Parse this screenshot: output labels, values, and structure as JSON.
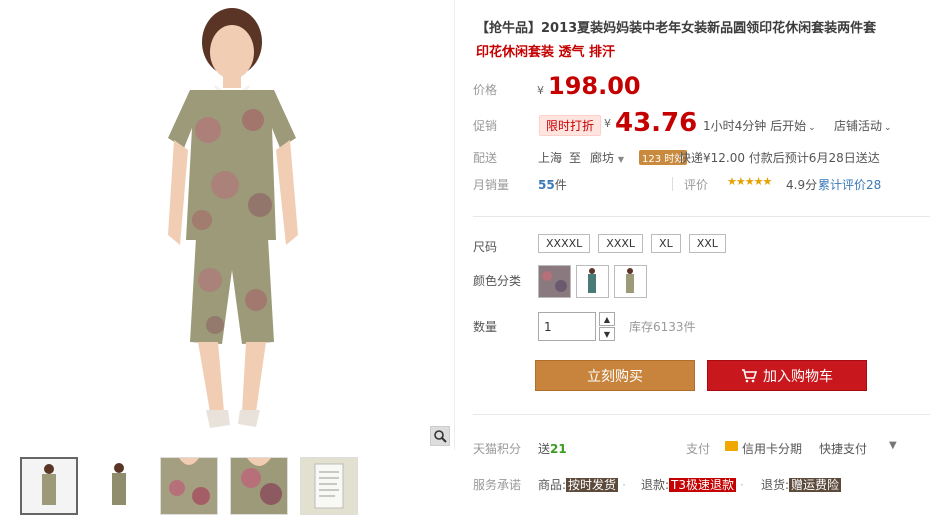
{
  "title": "【抢牛品】2013夏装妈妈装中老年女装新品圆领印花休闲套装两件套",
  "subtitle": "印花休闲套装 透气 排汗",
  "price": {
    "label": "价格",
    "currency": "¥",
    "value": "198.00"
  },
  "promo": {
    "label": "促销",
    "tag": "限时打折",
    "currency": "¥",
    "value": "43.76",
    "countdown": "1小时4分钟 后开始",
    "store_activity": "店铺活动"
  },
  "shipping": {
    "label": "配送",
    "from": "上海",
    "to": "至",
    "dest": "廊坊",
    "badge": "123 时效",
    "info": "快递¥12.00 付款后预计6月28日送达"
  },
  "sales": {
    "label": "月销量",
    "count": "55",
    "unit": "件",
    "review_label": "评价",
    "stars": "★★★★★",
    "score": "4.9分",
    "total_reviews": "累计评价28"
  },
  "size": {
    "label": "尺码",
    "options": [
      "XXXXL",
      "XXXL",
      "XL",
      "XXL"
    ]
  },
  "color": {
    "label": "颜色分类"
  },
  "quantity": {
    "label": "数量",
    "value": "1",
    "stock": "库存6133件"
  },
  "buttons": {
    "buy": "立刻购买",
    "cart": "加入购物车"
  },
  "points": {
    "label": "天猫积分",
    "prefix": "送",
    "value": "21",
    "pay_label": "支付",
    "credit": "信用卡分期",
    "quick_pay": "快捷支付"
  },
  "service": {
    "label": "服务承诺",
    "item1_prefix": "商品:",
    "item1_tag": "按时发货",
    "item2_prefix": "退款:",
    "item2_tag": "T3极速退款",
    "item3_prefix": "退货:",
    "item3_tag": "赠运费险"
  },
  "colors": {
    "price_red": "#c40000",
    "buy_orange": "#c8843d",
    "cart_red": "#c8181d",
    "link_blue": "#3a7ab8"
  }
}
